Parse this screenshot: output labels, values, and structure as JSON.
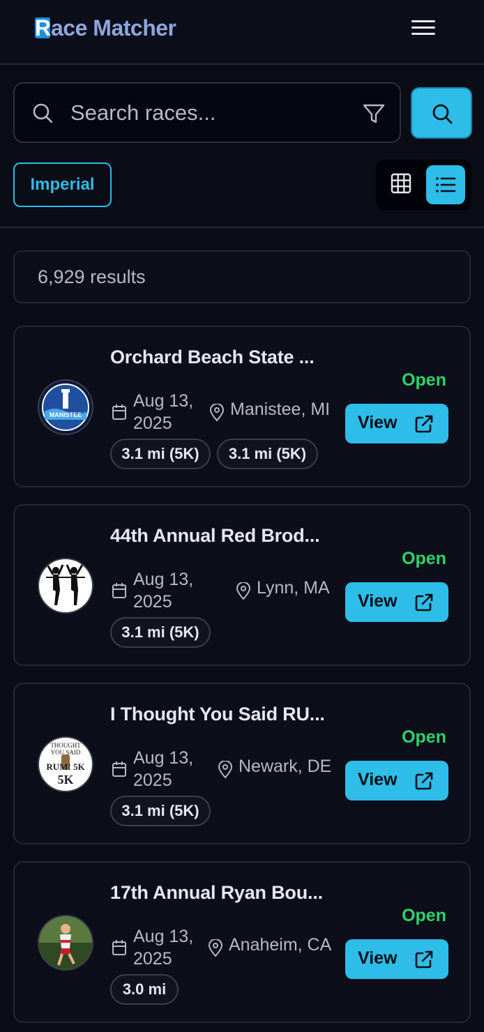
{
  "header": {
    "logo_initial": "R",
    "logo_rest": "ace Matcher"
  },
  "search": {
    "placeholder": "Search races...",
    "value": ""
  },
  "toolbar": {
    "units_label": "Imperial",
    "active_view": "list"
  },
  "results": {
    "count_text": "6,929 results"
  },
  "races": [
    {
      "title": "Orchard Beach State ...",
      "date_line1": "Aug 13,",
      "date_line2": "2025",
      "location": "Manistee, MI",
      "distances": [
        "3.1 mi (5K)",
        "3.1 mi (5K)"
      ],
      "status": "Open",
      "action_label": "View",
      "avatar_text": "MANISTEE"
    },
    {
      "title": "44th Annual Red Brod...",
      "date_line1": "Aug 13,",
      "date_line2": "2025",
      "location": "Lynn, MA",
      "distances": [
        "3.1 mi (5K)"
      ],
      "status": "Open",
      "action_label": "View",
      "avatar_text": ""
    },
    {
      "title": "I Thought You Said RU...",
      "date_line1": "Aug 13,",
      "date_line2": "2025",
      "location": "Newark, DE",
      "distances": [
        "3.1 mi (5K)"
      ],
      "status": "Open",
      "action_label": "View",
      "avatar_text": "RUM! 5K"
    },
    {
      "title": "17th Annual Ryan Bou...",
      "date_line1": "Aug 13,",
      "date_line2": "2025",
      "location": "Anaheim, CA",
      "distances": [
        "3.0 mi"
      ],
      "status": "Open",
      "action_label": "View",
      "avatar_text": ""
    }
  ],
  "colors": {
    "accent": "#2dbde8",
    "open": "#2ed36a",
    "background": "#0a0c16"
  }
}
